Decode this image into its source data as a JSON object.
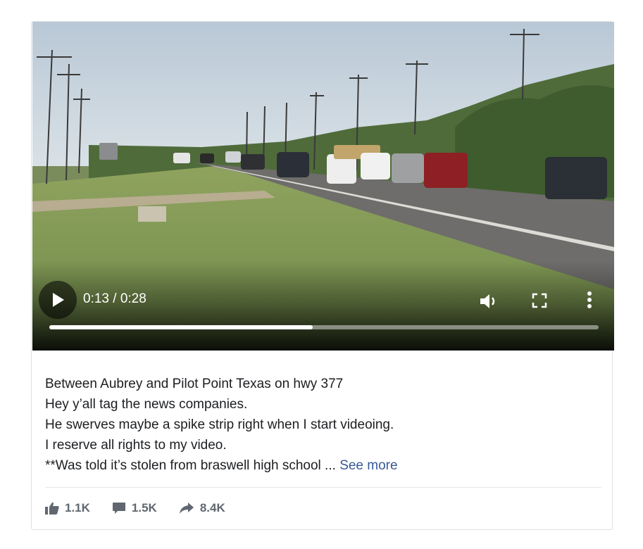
{
  "video": {
    "play_label": "Play",
    "time": "0:13 / 0:28",
    "progress_fraction": 0.48
  },
  "post": {
    "lines": [
      "Between Aubrey and Pilot Point Texas on hwy 377",
      "Hey y’all tag the news companies.",
      "He swerves maybe a spike strip right when I start videoing.",
      "I reserve all rights to my video.",
      "**Was told it’s stolen from braswell high school ... "
    ],
    "see_more": "See more"
  },
  "stats": {
    "likes": "1.1K",
    "comments": "1.5K",
    "shares": "8.4K"
  },
  "icons": {
    "play": "play-icon",
    "volume": "volume-icon",
    "fullscreen": "fullscreen-icon",
    "more": "more-vertical-icon",
    "like": "thumbs-up-icon",
    "comment": "comment-icon",
    "share": "share-arrow-icon"
  }
}
